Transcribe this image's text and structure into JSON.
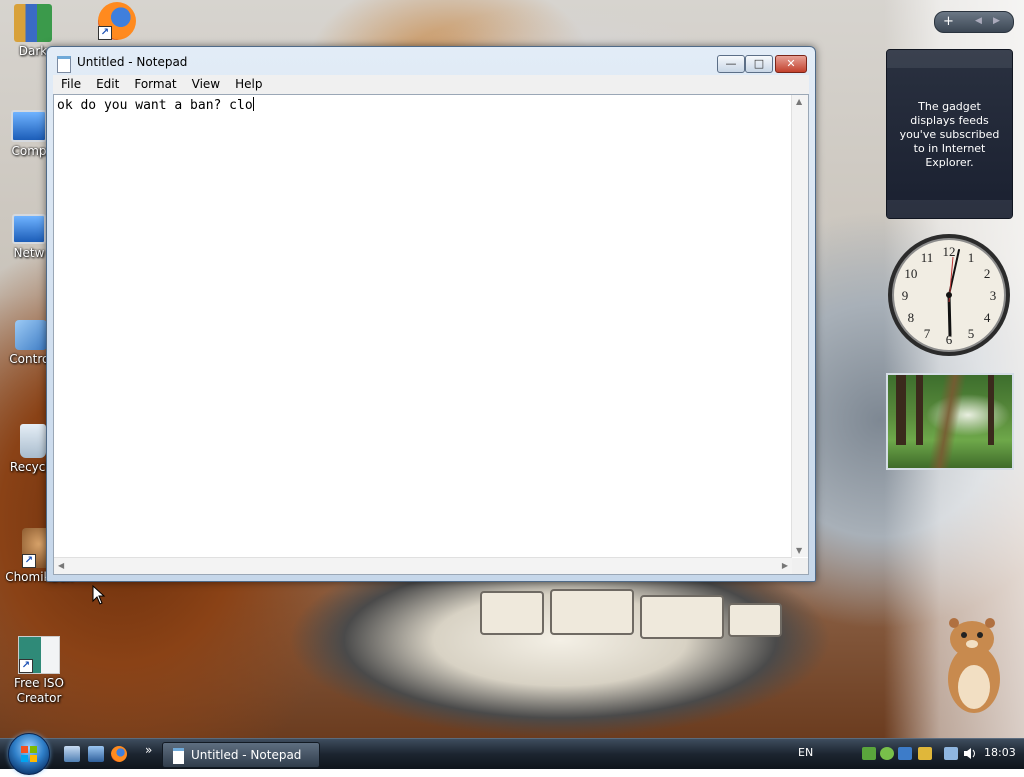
{
  "desktop": {
    "icons": [
      {
        "label": "Dark"
      },
      {
        "label": "Comp"
      },
      {
        "label": "Netw"
      },
      {
        "label": "Control"
      },
      {
        "label": "Recycle"
      },
      {
        "label": "ChomikBox"
      },
      {
        "label": "Free ISO Creator"
      }
    ]
  },
  "notepad": {
    "title": "Untitled - Notepad",
    "menu": [
      "File",
      "Edit",
      "Format",
      "View",
      "Help"
    ],
    "content": "ok do you want a ban? clo",
    "minimize": "—",
    "maximize": "□",
    "close": "✕"
  },
  "gadgets": {
    "feed_text": "The gadget displays feeds you've subscribed to in Internet Explorer.",
    "controls": [
      "+",
      "◀",
      "▶"
    ],
    "clock": {
      "numbers": [
        "12",
        "1",
        "2",
        "3",
        "4",
        "5",
        "6",
        "7",
        "8",
        "9",
        "10",
        "11"
      ],
      "time": "18:03"
    }
  },
  "taskbar": {
    "task_label": "Untitled - Notepad",
    "overflow": "»",
    "language": "EN",
    "clock": "18:03"
  },
  "colors": {
    "taskbar": "#1c2530",
    "window_frame": "#c6d7ea",
    "close_button": "#c2412d",
    "gadget_dark": "#1a2030"
  }
}
